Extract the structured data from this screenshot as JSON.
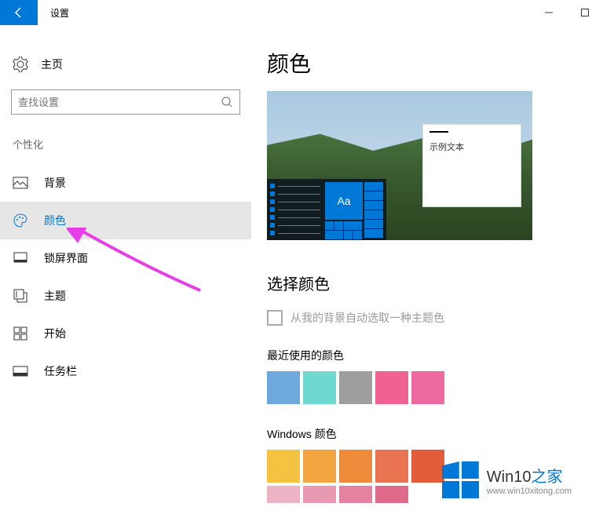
{
  "window": {
    "title": "设置"
  },
  "sidebar": {
    "home": "主页",
    "search_placeholder": "查找设置",
    "section": "个性化",
    "items": [
      {
        "label": "背景"
      },
      {
        "label": "颜色"
      },
      {
        "label": "锁屏界面"
      },
      {
        "label": "主题"
      },
      {
        "label": "开始"
      },
      {
        "label": "任务栏"
      }
    ]
  },
  "main": {
    "title": "颜色",
    "preview_sample": "示例文本",
    "preview_tile": "Aa",
    "choose_heading": "选择颜色",
    "checkbox_label": "从我的背景自动选取一种主题色",
    "recent_heading": "最近使用的颜色",
    "recent_colors": [
      "#6fa8dc",
      "#6fd9cf",
      "#9e9e9e",
      "#f06292",
      "#ec6aa0"
    ],
    "windows_heading": "Windows 颜色",
    "windows_colors_row1": [
      "#f5c242",
      "#f2a541",
      "#ed8b3b",
      "#e97451",
      "#e25d3a"
    ],
    "windows_colors_row2": [
      "#ecb3c5",
      "#e89ab3",
      "#e4829f",
      "#e06a8a"
    ]
  },
  "watermark": {
    "brand_a": "Win10",
    "brand_b": "之家",
    "url": "www.win10xitong.com"
  }
}
